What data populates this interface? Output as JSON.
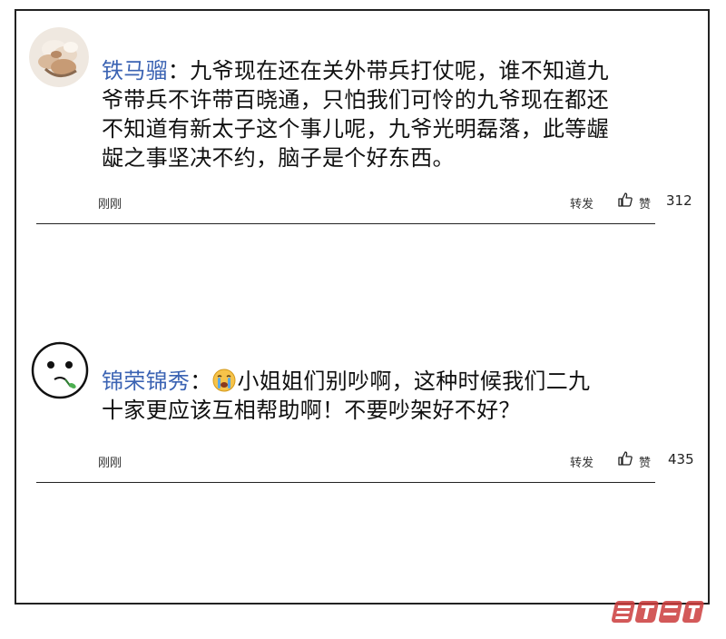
{
  "comments": [
    {
      "username": "铁马骝",
      "separator": "：",
      "lines": [
        "九爷现在还在关外带兵打仗呢，谁不知道九",
        "爷带兵不许带百晓通，只怕我们可怜的九爷现在都还",
        "不知道有新太子这个事儿呢，九爷光明磊落，此等龌",
        "龊之事坚决不约，脑子是个好东西。"
      ],
      "time": "刚刚",
      "share_label": "转发",
      "like_label": "赞",
      "like_count": "312",
      "avatar_icon": "flower-bouquet-avatar"
    },
    {
      "username": "锦荣锦秀",
      "separator": "：",
      "emoji": "crying-face-emoji",
      "lines": [
        "小姐姐们别吵啊，这种时候我们二九",
        "十家更应该互相帮助啊！不要吵架好不好？"
      ],
      "time": "刚刚",
      "share_label": "转发",
      "like_label": "赞",
      "like_count": "435",
      "avatar_icon": "cartoon-face-avatar"
    }
  ],
  "colors": {
    "username": "#3b63b3",
    "text": "#111111",
    "border": "#222222",
    "watermark": "#cc3d3d"
  },
  "watermark": {
    "icon": "manhua-site-logo"
  }
}
